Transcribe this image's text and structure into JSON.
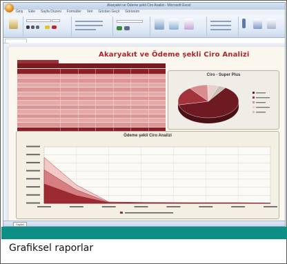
{
  "window": {
    "title": "Akaryakıt ve Ödeme şekli Ciro Analizi - Microsoft Excel",
    "tabs": [
      "Giriş",
      "Ekle",
      "Sayfa Düzeni",
      "Formüller",
      "Veri",
      "Gözden Geçir",
      "Görünüm"
    ]
  },
  "sheet": {
    "title": "Akaryakıt ve Ödeme şekli Ciro Analizi",
    "tab_name": "Sayfa1",
    "table_rows": 14,
    "table_cols": 7
  },
  "pie_chart": {
    "title": "Ciro - Super Plus"
  },
  "line_chart": {
    "title": "Ödeme şekli Ciro Analizi"
  },
  "caption": "Grafiksel raporlar",
  "colors": {
    "accent_red": "#b0222b",
    "table_dark": "#8a1f26",
    "table_light": "#e7a9a6",
    "caption_band": "#0d8f86"
  },
  "chart_data": [
    {
      "type": "pie",
      "title": "Ciro - Super Plus",
      "values": [
        62,
        18,
        10,
        6,
        4
      ],
      "colors": [
        "#6e1a22",
        "#a3333b",
        "#d88c8c",
        "#ead0cc",
        "#c9c1b6"
      ]
    },
    {
      "type": "area",
      "title": "Ödeme şekli Ciro Analizi",
      "categories": [
        "",
        "",
        "",
        "",
        "",
        "",
        "",
        ""
      ],
      "series": [
        {
          "values": [
            130,
            52,
            4,
            3,
            2,
            2,
            2,
            1
          ],
          "color": "#f2c9c6"
        },
        {
          "values": [
            95,
            38,
            3,
            2,
            2,
            1,
            1,
            1
          ],
          "color": "#d77e80"
        },
        {
          "values": [
            55,
            22,
            2,
            1,
            1,
            1,
            1,
            0
          ],
          "color": "#9b2a33"
        }
      ],
      "ylim": [
        0,
        160
      ]
    }
  ]
}
